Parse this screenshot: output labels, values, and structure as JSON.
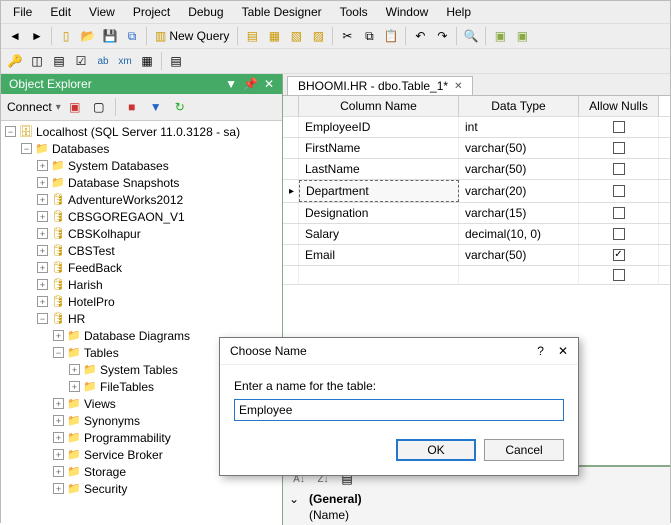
{
  "menu": [
    "File",
    "Edit",
    "View",
    "Project",
    "Debug",
    "Table Designer",
    "Tools",
    "Window",
    "Help"
  ],
  "newQuery": "New Query",
  "connectLabel": "Connect",
  "panelTitle": "Object Explorer",
  "tree": {
    "root": "Localhost (SQL Server 11.0.3128 - sa)",
    "dbFolder": "Databases",
    "sysDb": "System Databases",
    "snap": "Database Snapshots",
    "dbs": [
      "AdventureWorks2012",
      "CBSGOREGAON_V1",
      "CBSKolhapur",
      "CBSTest",
      "FeedBack",
      "Harish",
      "HotelPro"
    ],
    "hr": "HR",
    "hrChildren": {
      "diagrams": "Database Diagrams",
      "tables": "Tables",
      "systables": "System Tables",
      "filetables": "FileTables",
      "views": "Views",
      "synonyms": "Synonyms",
      "prog": "Programmability",
      "sb": "Service Broker",
      "storage": "Storage",
      "security": "Security"
    }
  },
  "tabLabel": "BHOOMI.HR - dbo.Table_1*",
  "gridHead": {
    "col": "Column Name",
    "type": "Data Type",
    "nulls": "Allow Nulls"
  },
  "rows": [
    {
      "col": "EmployeeID",
      "type": "int",
      "null": false,
      "sel": false
    },
    {
      "col": "FirstName",
      "type": "varchar(50)",
      "null": false,
      "sel": false
    },
    {
      "col": "LastName",
      "type": "varchar(50)",
      "null": false,
      "sel": false
    },
    {
      "col": "Department",
      "type": "varchar(20)",
      "null": false,
      "sel": true
    },
    {
      "col": "Designation",
      "type": "varchar(15)",
      "null": false,
      "sel": false
    },
    {
      "col": "Salary",
      "type": "decimal(10, 0)",
      "null": false,
      "sel": false
    },
    {
      "col": "Email",
      "type": "varchar(50)",
      "null": true,
      "sel": false
    }
  ],
  "props": {
    "general": "(General)",
    "name": "(Name)"
  },
  "dialog": {
    "title": "Choose Name",
    "prompt": "Enter a name for the table:",
    "value": "Employee",
    "ok": "OK",
    "cancel": "Cancel"
  }
}
